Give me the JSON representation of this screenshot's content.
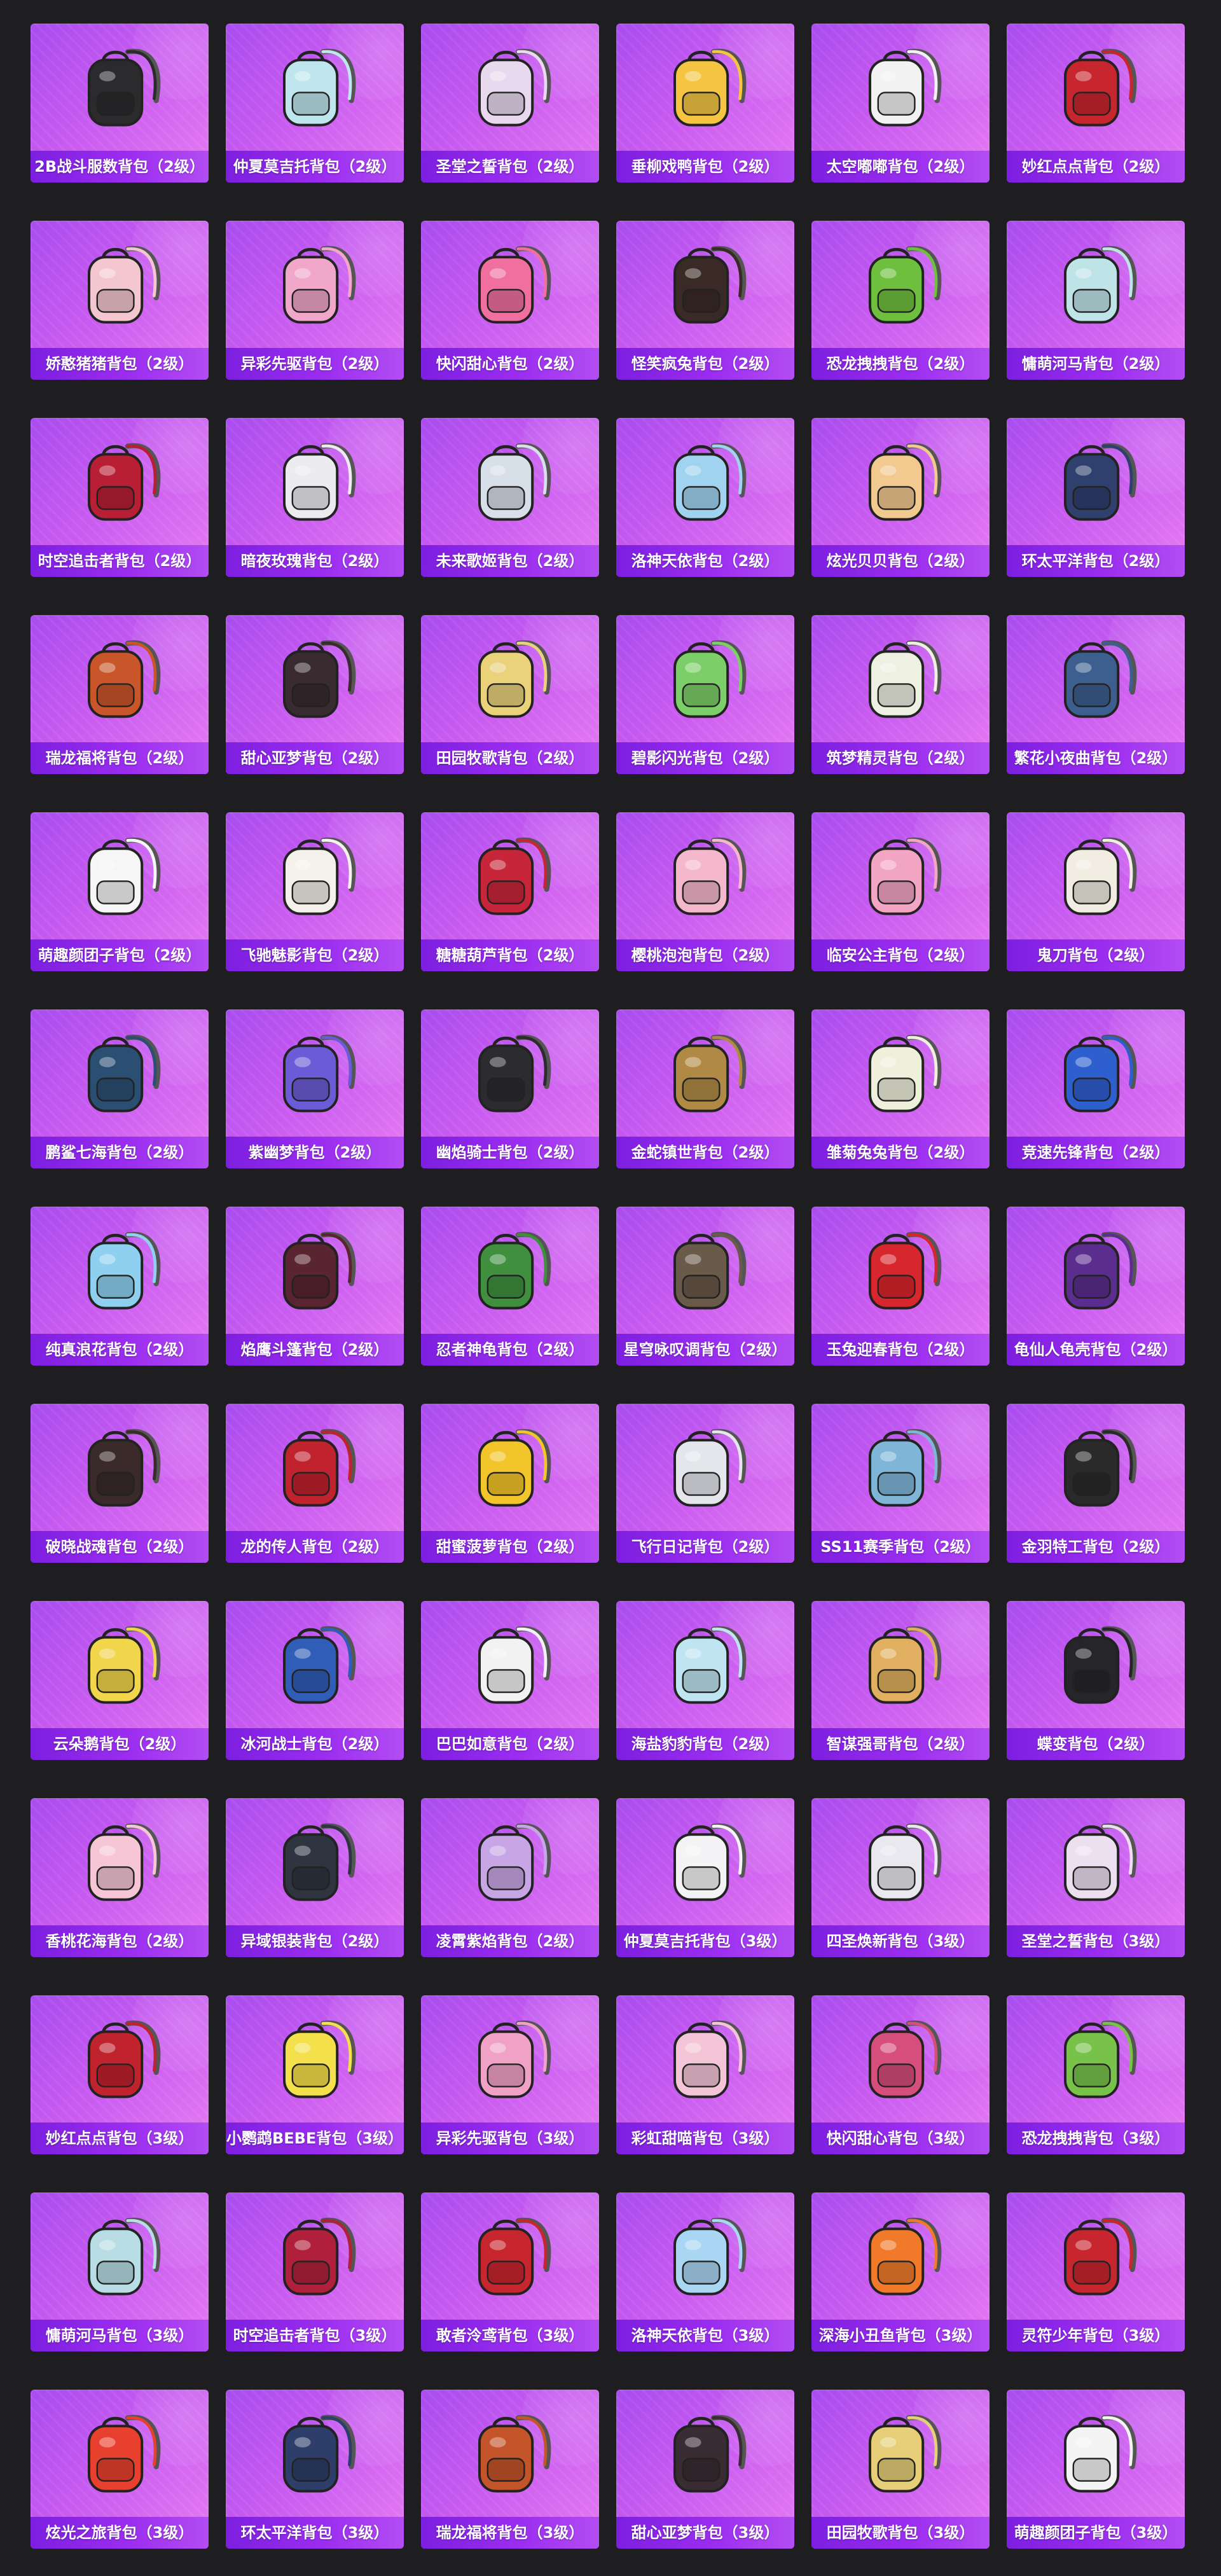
{
  "colors": {
    "page_background": "#1e1e20",
    "tile_gradient_start": "#a94cef",
    "tile_gradient_end": "#e67bf2",
    "caption_bar": "#7d1fe0",
    "caption_text": "#ffffff"
  },
  "items": [
    {
      "name": "2B战斗服数背包（2级）",
      "icon": "backpack-icon",
      "color": "#2b2b2e"
    },
    {
      "name": "仲夏莫吉托背包（2级）",
      "icon": "backpack-icon",
      "color": "#bfe6ef"
    },
    {
      "name": "圣堂之誓背包（2级）",
      "icon": "backpack-icon",
      "color": "#e9d9ef"
    },
    {
      "name": "垂柳戏鸭背包（2级）",
      "icon": "backpack-icon",
      "color": "#f5c542"
    },
    {
      "name": "太空嘟嘟背包（2级）",
      "icon": "backpack-icon",
      "color": "#f2f2f2"
    },
    {
      "name": "妙红点点背包（2级）",
      "icon": "backpack-icon",
      "color": "#c8262e"
    },
    {
      "name": "娇憨猪猪背包（2级）",
      "icon": "backpack-icon",
      "color": "#f4c6cf"
    },
    {
      "name": "异彩先驱背包（2级）",
      "icon": "backpack-icon",
      "color": "#f0a7c9"
    },
    {
      "name": "快闪甜心背包（2级）",
      "icon": "backpack-icon",
      "color": "#f06f9e"
    },
    {
      "name": "怪笑疯兔背包（2级）",
      "icon": "backpack-icon",
      "color": "#3a2a26"
    },
    {
      "name": "恐龙拽拽背包（2级）",
      "icon": "backpack-icon",
      "color": "#6fbf3f"
    },
    {
      "name": "慵萌河马背包（2级）",
      "icon": "backpack-icon",
      "color": "#bfe4e8"
    },
    {
      "name": "时空追击者背包（2级）",
      "icon": "backpack-icon",
      "color": "#b81f35"
    },
    {
      "name": "暗夜玫瑰背包（2级）",
      "icon": "backpack-icon",
      "color": "#ececf0"
    },
    {
      "name": "未来歌姬背包（2级）",
      "icon": "backpack-icon",
      "color": "#d7dfe8"
    },
    {
      "name": "洛神天依背包（2级）",
      "icon": "backpack-icon",
      "color": "#9fd3f0"
    },
    {
      "name": "炫光贝贝背包（2级）",
      "icon": "backpack-icon",
      "color": "#f2c98f"
    },
    {
      "name": "环太平洋背包（2级）",
      "icon": "backpack-icon",
      "color": "#2f3f6e"
    },
    {
      "name": "瑞龙福将背包（2级）",
      "icon": "backpack-icon",
      "color": "#c8562a"
    },
    {
      "name": "甜心亚梦背包（2级）",
      "icon": "backpack-icon",
      "color": "#3a2b30"
    },
    {
      "name": "田园牧歌背包（2级）",
      "icon": "backpack-icon",
      "color": "#e9d27a"
    },
    {
      "name": "碧影闪光背包（2级）",
      "icon": "backpack-icon",
      "color": "#7ccf68"
    },
    {
      "name": "筑梦精灵背包（2级）",
      "icon": "backpack-icon",
      "color": "#eef0e2"
    },
    {
      "name": "繁花小夜曲背包（2级）",
      "icon": "backpack-icon",
      "color": "#3d5f8f"
    },
    {
      "name": "萌趣颜团子背包（2级）",
      "icon": "backpack-icon",
      "color": "#f6f6f6"
    },
    {
      "name": "飞驰魅影背包（2级）",
      "icon": "backpack-icon",
      "color": "#f4f1ea"
    },
    {
      "name": "糖糖葫芦背包（2级）",
      "icon": "backpack-icon",
      "color": "#c7263a"
    },
    {
      "name": "樱桃泡泡背包（2级）",
      "icon": "backpack-icon",
      "color": "#f4b7cc"
    },
    {
      "name": "临安公主背包（2级）",
      "icon": "backpack-icon",
      "color": "#f3a5c4"
    },
    {
      "name": "鬼刀背包（2级）",
      "icon": "backpack-icon",
      "color": "#f1ede2"
    },
    {
      "name": "鹏鲨七海背包（2级）",
      "icon": "backpack-icon",
      "color": "#2b4f73"
    },
    {
      "name": "紫幽梦背包（2级）",
      "icon": "backpack-icon",
      "color": "#6c5bd6"
    },
    {
      "name": "幽焰骑士背包（2级）",
      "icon": "backpack-icon",
      "color": "#2c2c30"
    },
    {
      "name": "金蛇镇世背包（2级）",
      "icon": "backpack-icon",
      "color": "#b08a45"
    },
    {
      "name": "雏菊兔兔背包（2级）",
      "icon": "backpack-icon",
      "color": "#eef0dc"
    },
    {
      "name": "竞速先锋背包（2级）",
      "icon": "backpack-icon",
      "color": "#2e5fcf"
    },
    {
      "name": "纯真浪花背包（2级）",
      "icon": "backpack-icon",
      "color": "#8fd0f0"
    },
    {
      "name": "焰鹰斗篷背包（2级）",
      "icon": "backpack-icon",
      "color": "#5a2430"
    },
    {
      "name": "忍者神龟背包（2级）",
      "icon": "backpack-icon",
      "color": "#3f8f3f"
    },
    {
      "name": "星穹咏叹调背包（2级）",
      "icon": "backpack-icon",
      "color": "#6a5a4a"
    },
    {
      "name": "玉兔迎春背包（2级）",
      "icon": "backpack-icon",
      "color": "#d8262e"
    },
    {
      "name": "龟仙人龟壳背包（2级）",
      "icon": "backpack-icon",
      "color": "#5b2d8f"
    },
    {
      "name": "破晓战魂背包（2级）",
      "icon": "backpack-icon",
      "color": "#3a2a2a"
    },
    {
      "name": "龙的传人背包（2级）",
      "icon": "backpack-icon",
      "color": "#c0222e"
    },
    {
      "name": "甜蜜菠萝背包（2级）",
      "icon": "backpack-icon",
      "color": "#f2c52a"
    },
    {
      "name": "飞行日记背包（2级）",
      "icon": "backpack-icon",
      "color": "#e4e6ec"
    },
    {
      "name": "SS11赛季背包（2级）",
      "icon": "backpack-icon",
      "color": "#7fb6d8"
    },
    {
      "name": "金羽特工背包（2级）",
      "icon": "backpack-icon",
      "color": "#2a2a2a"
    },
    {
      "name": "云朵鹅背包（2级）",
      "icon": "backpack-icon",
      "color": "#f1d54a"
    },
    {
      "name": "冰河战士背包（2级）",
      "icon": "backpack-icon",
      "color": "#2f5db8"
    },
    {
      "name": "巴巴如意背包（2级）",
      "icon": "backpack-icon",
      "color": "#f2f2f2"
    },
    {
      "name": "海盐豹豹背包（2级）",
      "icon": "backpack-icon",
      "color": "#bfe4f2"
    },
    {
      "name": "智谋强哥背包（2级）",
      "icon": "backpack-icon",
      "color": "#e0b060"
    },
    {
      "name": "蝶变背包（2级）",
      "icon": "backpack-icon",
      "color": "#26262a"
    },
    {
      "name": "香桃花海背包（2级）",
      "icon": "backpack-icon",
      "color": "#f6c6d6"
    },
    {
      "name": "异域银装背包（2级）",
      "icon": "backpack-icon",
      "color": "#2e3440"
    },
    {
      "name": "凌霄紫焰背包（2级）",
      "icon": "backpack-icon",
      "color": "#c8a6e6"
    },
    {
      "name": "仲夏莫吉托背包（3级）",
      "icon": "backpack-icon",
      "color": "#f4f4f6"
    },
    {
      "name": "四圣焕新背包（3级）",
      "icon": "backpack-icon",
      "color": "#e8e8ee"
    },
    {
      "name": "圣堂之誓背包（3级）",
      "icon": "backpack-icon",
      "color": "#ece0f0"
    },
    {
      "name": "妙红点点背包（3级）",
      "icon": "backpack-icon",
      "color": "#c0222e"
    },
    {
      "name": "小鹦鹉BEBE背包（3级）",
      "icon": "backpack-icon",
      "color": "#f4e04a"
    },
    {
      "name": "异彩先驱背包（3级）",
      "icon": "backpack-icon",
      "color": "#f0a2c6"
    },
    {
      "name": "彩虹甜喵背包（3级）",
      "icon": "backpack-icon",
      "color": "#f3c5d6"
    },
    {
      "name": "快闪甜心背包（3级）",
      "icon": "backpack-icon",
      "color": "#d64f7c"
    },
    {
      "name": "恐龙拽拽背包（3级）",
      "icon": "backpack-icon",
      "color": "#78c24a"
    },
    {
      "name": "慵萌河马背包（3级）",
      "icon": "backpack-icon",
      "color": "#b8dde4"
    },
    {
      "name": "时空追击者背包（3级）",
      "icon": "backpack-icon",
      "color": "#b0203a"
    },
    {
      "name": "敢者泠鸢背包（3级）",
      "icon": "backpack-icon",
      "color": "#c8262e"
    },
    {
      "name": "洛神天依背包（3级）",
      "icon": "backpack-icon",
      "color": "#a9d6f2"
    },
    {
      "name": "深海小丑鱼背包（3级）",
      "icon": "backpack-icon",
      "color": "#f07a2a"
    },
    {
      "name": "灵符少年背包（3级）",
      "icon": "backpack-icon",
      "color": "#c8262e"
    },
    {
      "name": "炫光之旅背包（3级）",
      "icon": "backpack-icon",
      "color": "#e8402e"
    },
    {
      "name": "环太平洋背包（3级）",
      "icon": "backpack-icon",
      "color": "#2d3e6a"
    },
    {
      "name": "瑞龙福将背包（3级）",
      "icon": "backpack-icon",
      "color": "#c4542a"
    },
    {
      "name": "甜心亚梦背包（3级）",
      "icon": "backpack-icon",
      "color": "#3a2c33"
    },
    {
      "name": "田园牧歌背包（3级）",
      "icon": "backpack-icon",
      "color": "#e6cf78"
    },
    {
      "name": "萌趣颜团子背包（3级）",
      "icon": "backpack-icon",
      "color": "#f4f4f4"
    }
  ]
}
